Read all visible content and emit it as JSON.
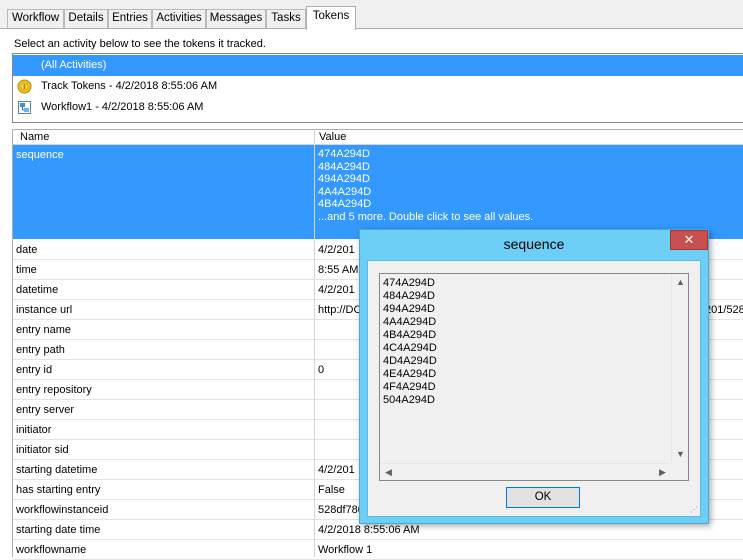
{
  "tabs": [
    {
      "label": "Workflow"
    },
    {
      "label": "Details"
    },
    {
      "label": "Entries"
    },
    {
      "label": "Activities"
    },
    {
      "label": "Messages"
    },
    {
      "label": "Tasks"
    },
    {
      "label": "Tokens"
    }
  ],
  "active_tab": "Tokens",
  "instruction": "Select an activity below to see the tokens it tracked.",
  "activities": [
    {
      "label": "(All Activities)",
      "icon": "none",
      "selected": true
    },
    {
      "label": "Track Tokens - 4/2/2018 8:55:06 AM",
      "icon": "track-tokens-icon"
    },
    {
      "label": "Workflow1 - 4/2/2018 8:55:06 AM",
      "icon": "workflow-icon"
    }
  ],
  "grid": {
    "headers": {
      "name": "Name",
      "value": "Value"
    },
    "sequence": {
      "name": "sequence",
      "values": [
        "474A294D",
        "484A294D",
        "494A294D",
        "4A4A294D",
        "4B4A294D",
        "...and 5 more. Double click to see all values."
      ]
    },
    "rows": [
      {
        "name": "date",
        "value": "4/2/201"
      },
      {
        "name": "time",
        "value": "8:55 AM"
      },
      {
        "name": "datetime",
        "value": "4/2/201"
      },
      {
        "name": "instance url",
        "value": "http://DC",
        "value_right": "201/528"
      },
      {
        "name": "entry name",
        "value": ""
      },
      {
        "name": "entry path",
        "value": ""
      },
      {
        "name": "entry id",
        "value": "0"
      },
      {
        "name": "entry repository",
        "value": ""
      },
      {
        "name": "entry server",
        "value": ""
      },
      {
        "name": "initiator",
        "value": ""
      },
      {
        "name": "initiator sid",
        "value": ""
      },
      {
        "name": "starting datetime",
        "value": "4/2/201"
      },
      {
        "name": "has starting entry",
        "value": "False"
      },
      {
        "name": "workflowinstanceid",
        "value": "528df780"
      },
      {
        "name": "starting date time",
        "value": "4/2/2018 8:55:06 AM"
      },
      {
        "name": "workflowname",
        "value": "Workflow 1"
      }
    ]
  },
  "dialog": {
    "title": "sequence",
    "close": "✕",
    "values": [
      "474A294D",
      "484A294D",
      "494A294D",
      "4A4A294D",
      "4B4A294D",
      "4C4A294D",
      "4D4A294D",
      "4E4A294D",
      "4F4A294D",
      "504A294D"
    ],
    "ok_label": "OK"
  }
}
